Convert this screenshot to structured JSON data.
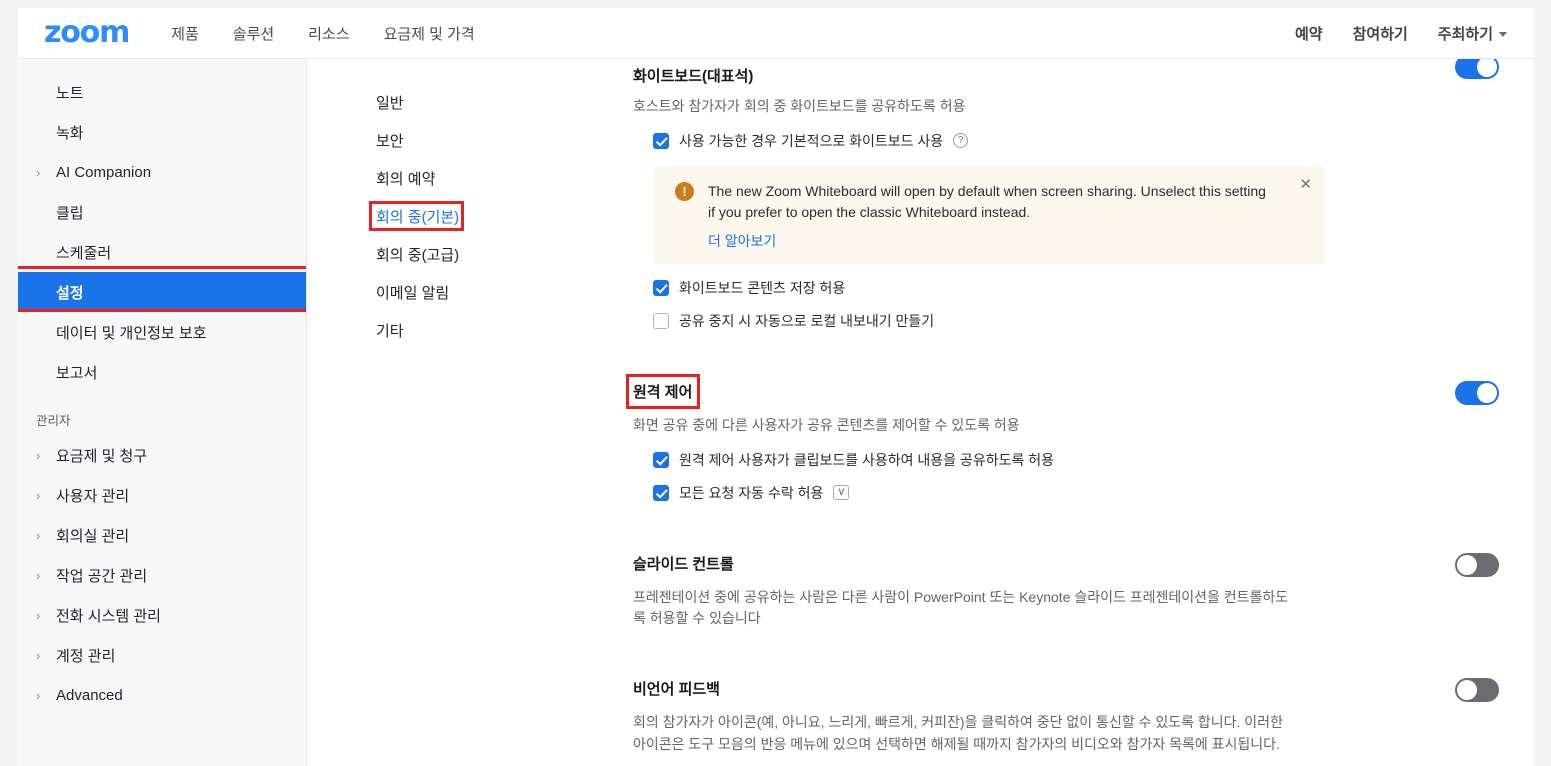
{
  "header": {
    "brand": "zoom",
    "nav_left": [
      {
        "label": "제품"
      },
      {
        "label": "솔루션"
      },
      {
        "label": "리소스"
      },
      {
        "label": "요금제 및 가격"
      }
    ],
    "nav_right": [
      {
        "label": "예약",
        "caret": false
      },
      {
        "label": "참여하기",
        "caret": false
      },
      {
        "label": "주최하기",
        "caret": true
      }
    ]
  },
  "sidebar": {
    "items": [
      {
        "label": "노트",
        "chevron": false,
        "selected": false
      },
      {
        "label": "녹화",
        "chevron": false,
        "selected": false
      },
      {
        "label": "AI Companion",
        "chevron": true,
        "selected": false
      },
      {
        "label": "클립",
        "chevron": false,
        "selected": false
      },
      {
        "label": "스케줄러",
        "chevron": false,
        "selected": false
      },
      {
        "label": "설정",
        "chevron": false,
        "selected": true
      },
      {
        "label": "데이터 및 개인정보 보호",
        "chevron": false,
        "selected": false
      },
      {
        "label": "보고서",
        "chevron": false,
        "selected": false
      }
    ],
    "group_label": "관리자",
    "admin_items": [
      {
        "label": "요금제 및 청구",
        "chevron": true
      },
      {
        "label": "사용자 관리",
        "chevron": true
      },
      {
        "label": "회의실 관리",
        "chevron": true
      },
      {
        "label": "작업 공간 관리",
        "chevron": true
      },
      {
        "label": "전화 시스템 관리",
        "chevron": true
      },
      {
        "label": "계정 관리",
        "chevron": true
      },
      {
        "label": "Advanced",
        "chevron": true
      }
    ]
  },
  "subnav": {
    "items": [
      {
        "label": "일반",
        "active": false
      },
      {
        "label": "보안",
        "active": false
      },
      {
        "label": "회의 예약",
        "active": false
      },
      {
        "label": "회의 중(기본)",
        "active": true
      },
      {
        "label": "회의 중(고급)",
        "active": false
      },
      {
        "label": "이메일 알림",
        "active": false
      },
      {
        "label": "기타",
        "active": false
      }
    ]
  },
  "main": {
    "whiteboard": {
      "title": "화이트보드(대표석)",
      "description": "호스트와 참가자가 회의 중 화이트보드를 공유하도록 허용",
      "toggle_state": "on",
      "check_default": {
        "label": "사용 가능한 경우 기본적으로 화이트보드 사용",
        "checked": true,
        "info_glyph": "?"
      },
      "alert": {
        "icon_glyph": "!",
        "text": "The new Zoom Whiteboard will open by default when screen sharing. Unselect this setting if you prefer to open the classic Whiteboard instead.",
        "link": "더 알아보기",
        "close_glyph": "✕"
      },
      "checks": [
        {
          "label": "화이트보드 콘텐츠 저장 허용",
          "checked": true
        },
        {
          "label": "공유 중지 시 자동으로 로컬 내보내기 만들기",
          "checked": false
        }
      ]
    },
    "remote_control": {
      "title": "원격 제어",
      "description": "화면 공유 중에 다른 사용자가 공유 콘텐츠를 제어할 수 있도록 허용",
      "toggle_state": "on",
      "checks": [
        {
          "label": "원격 제어 사용자가 클립보드를 사용하여 내용을 공유하도록 허용",
          "checked": true,
          "badge": ""
        },
        {
          "label": "모든 요청 자동 수락 허용",
          "checked": true,
          "badge": "V"
        }
      ]
    },
    "slide_control": {
      "title": "슬라이드 컨트롤",
      "description": "프레젠테이션 중에 공유하는 사람은 다른 사람이 PowerPoint 또는 Keynote 슬라이드 프레젠테이션을 컨트롤하도록 허용할 수 있습니다",
      "toggle_state": "off"
    },
    "nonverbal_feedback": {
      "title": "비언어 피드백",
      "description": "회의 참가자가 아이콘(예, 아니요, 느리게, 빠르게, 커피잔)을 클릭하여 중단 없이 통신할 수 있도록 합니다. 이러한 아이콘은 도구 모음의 반응 메뉴에 있으며 선택하면 해제될 때까지 참가자의 비디오와 참가자 목록에 표시됩니다."
    }
  },
  "colors": {
    "brand_blue": "#2D8CFF",
    "accent_blue": "#1a73e8",
    "annotation_red": "#e8221f",
    "toggle_off_gray": "#6b6b74",
    "alert_bg": "#fdf8ee",
    "alert_icon": "#cf7c18"
  }
}
